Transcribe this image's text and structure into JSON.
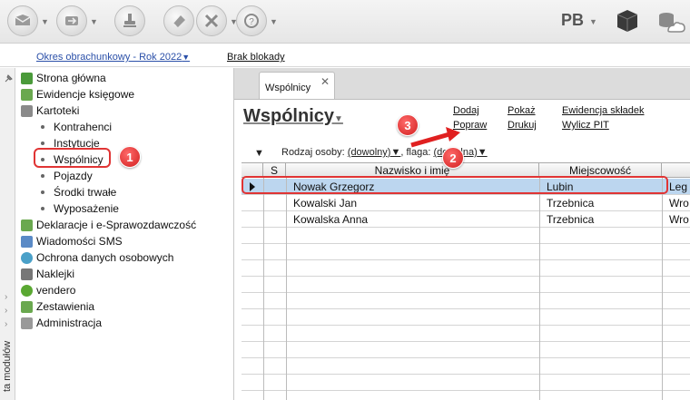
{
  "toolbar": {
    "buttons": [
      "mail-icon",
      "import-icon",
      "stamp-icon",
      "eraser-icon",
      "tools-icon",
      "help-icon"
    ],
    "user_initials": "PB"
  },
  "period": {
    "label": "Okres obrachunkowy - Rok 2022",
    "lock_status": "Brak blokady"
  },
  "strip": {
    "label": "ta modułów"
  },
  "sidebar": {
    "items": [
      {
        "label": "Strona główna",
        "icon": "home-icon",
        "color": "#4a9a3a"
      },
      {
        "label": "Ewidencje księgowe",
        "icon": "ledger-icon",
        "color": "#6aa84f"
      },
      {
        "label": "Kartoteki",
        "icon": "cards-icon",
        "color": "#8a8a8a"
      }
    ],
    "sub_items": [
      "Kontrahenci",
      "Instytucje",
      "Wspólnicy",
      "Pojazdy",
      "Środki trwałe",
      "Wyposażenie"
    ],
    "items_after": [
      {
        "label": "Deklaracje i e-Sprawozdawczość",
        "icon": "declaration-icon",
        "color": "#6aa84f"
      },
      {
        "label": "Wiadomości SMS",
        "icon": "sms-icon",
        "color": "#5a8ac6"
      },
      {
        "label": "Ochrona danych osobowych",
        "icon": "shield-icon",
        "color": "#4aa0c8"
      },
      {
        "label": "Naklejki",
        "icon": "sticker-icon",
        "color": "#777777"
      },
      {
        "label": "vendero",
        "icon": "vendero-icon",
        "color": "#5aa832"
      },
      {
        "label": "Zestawienia",
        "icon": "chart-icon",
        "color": "#6aa84f"
      },
      {
        "label": "Administracja",
        "icon": "admin-icon",
        "color": "#999999"
      }
    ]
  },
  "callouts": [
    "1",
    "2",
    "3"
  ],
  "tab": {
    "label": "Wspólnicy",
    "close": "✕"
  },
  "page": {
    "title": "Wspólnicy",
    "actions": {
      "add": "Dodaj",
      "edit": "Popraw",
      "show": "Pokaż",
      "print": "Drukuj",
      "shares": "Ewidencja składek",
      "pit": "Wylicz PIT"
    },
    "filter": {
      "person_label": "Rodzaj osoby:",
      "person_value": "(dowolny)",
      "flag_label": ", flaga:",
      "flag_value": "(dowolna)"
    }
  },
  "grid": {
    "columns": [
      "S",
      "Nazwisko i imię",
      "Miejscowość"
    ],
    "rows": [
      {
        "name": "Nowak Grzegorz",
        "city": "Lubin",
        "extra": "Leg"
      },
      {
        "name": "Kowalski Jan",
        "city": "Trzebnica",
        "extra": "Wro"
      },
      {
        "name": "Kowalska Anna",
        "city": "Trzebnica",
        "extra": "Wro"
      }
    ]
  },
  "colors": {
    "callout": "#d11f1f",
    "selected_row": "#bcd6ef",
    "link": "#2a4fa8"
  }
}
